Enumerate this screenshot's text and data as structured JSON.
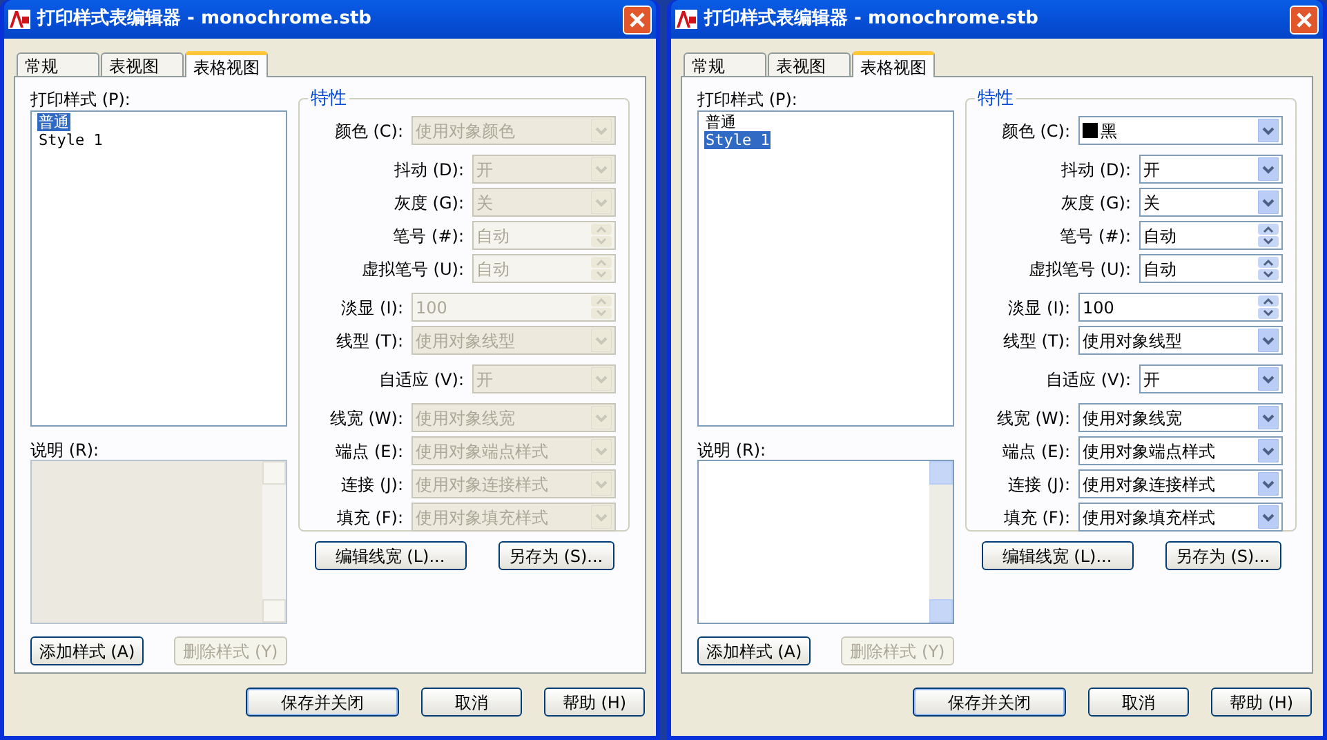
{
  "windows": [
    {
      "title": "打印样式表编辑器 - monochrome.stb",
      "tabs": [
        {
          "label": "常规",
          "selected": false
        },
        {
          "label": "表视图",
          "selected": false
        },
        {
          "label": "表格视图",
          "selected": true
        }
      ],
      "styles_label": "打印样式 (P):",
      "styles": [
        {
          "label": "普通",
          "selected": true
        },
        {
          "label": "Style 1",
          "selected": false
        }
      ],
      "description_label": "说明 (R):",
      "description": {
        "disabled": true
      },
      "list_buttons": [
        {
          "label": "添加样式 (A)",
          "disabled": false
        },
        {
          "label": "删除样式 (Y)",
          "disabled": true
        }
      ],
      "properties": {
        "title": "特性",
        "fields": [
          {
            "label": "颜色 (C):",
            "kind": "combo",
            "value": "使用对象颜色",
            "disabled": true
          },
          {
            "label": "抖动 (D):",
            "kind": "combo",
            "value": "开",
            "disabled": true
          },
          {
            "label": "灰度 (G):",
            "kind": "combo",
            "value": "关",
            "disabled": true
          },
          {
            "label": "笔号 (#):",
            "kind": "spin",
            "value": "自动",
            "disabled": true
          },
          {
            "label": "虚拟笔号 (U):",
            "kind": "spin",
            "value": "自动",
            "disabled": true
          },
          {
            "label": "淡显 (I):",
            "kind": "spin",
            "value": "100",
            "disabled": true
          },
          {
            "label": "线型 (T):",
            "kind": "combo",
            "value": "使用对象线型",
            "disabled": true
          },
          {
            "label": "自适应 (V):",
            "kind": "combo",
            "value": "开",
            "disabled": true
          },
          {
            "label": "线宽 (W):",
            "kind": "combo",
            "value": "使用对象线宽",
            "disabled": true
          },
          {
            "label": "端点 (E):",
            "kind": "combo",
            "value": "使用对象端点样式",
            "disabled": true
          },
          {
            "label": "连接 (J):",
            "kind": "combo",
            "value": "使用对象连接样式",
            "disabled": true
          },
          {
            "label": "填充 (F):",
            "kind": "combo",
            "value": "使用对象填充样式",
            "disabled": true
          }
        ]
      },
      "property_buttons": [
        "编辑线宽 (L)...",
        "另存为 (S)..."
      ],
      "footer_buttons": [
        "保存并关闭",
        "取消",
        "帮助 (H)"
      ]
    },
    {
      "title": "打印样式表编辑器 - monochrome.stb",
      "tabs": [
        {
          "label": "常规",
          "selected": false
        },
        {
          "label": "表视图",
          "selected": false
        },
        {
          "label": "表格视图",
          "selected": true
        }
      ],
      "styles_label": "打印样式 (P):",
      "styles": [
        {
          "label": "普通",
          "selected": false
        },
        {
          "label": "Style 1",
          "selected": true
        }
      ],
      "description_label": "说明 (R):",
      "description": {
        "disabled": false
      },
      "list_buttons": [
        {
          "label": "添加样式 (A)",
          "disabled": false
        },
        {
          "label": "删除样式 (Y)",
          "disabled": true
        }
      ],
      "properties": {
        "title": "特性",
        "fields": [
          {
            "label": "颜色 (C):",
            "kind": "combo",
            "value": "黑",
            "color": "#000000",
            "disabled": false
          },
          {
            "label": "抖动 (D):",
            "kind": "combo",
            "value": "开",
            "disabled": false
          },
          {
            "label": "灰度 (G):",
            "kind": "combo",
            "value": "关",
            "disabled": false
          },
          {
            "label": "笔号 (#):",
            "kind": "spin",
            "value": "自动",
            "disabled": false
          },
          {
            "label": "虚拟笔号 (U):",
            "kind": "spin",
            "value": "自动",
            "disabled": false
          },
          {
            "label": "淡显 (I):",
            "kind": "spin",
            "value": "100",
            "disabled": false
          },
          {
            "label": "线型 (T):",
            "kind": "combo",
            "value": "使用对象线型",
            "disabled": false
          },
          {
            "label": "自适应 (V):",
            "kind": "combo",
            "value": "开",
            "disabled": false
          },
          {
            "label": "线宽 (W):",
            "kind": "combo",
            "value": "使用对象线宽",
            "disabled": false
          },
          {
            "label": "端点 (E):",
            "kind": "combo",
            "value": "使用对象端点样式",
            "disabled": false
          },
          {
            "label": "连接 (J):",
            "kind": "combo",
            "value": "使用对象连接样式",
            "disabled": false
          },
          {
            "label": "填充 (F):",
            "kind": "combo",
            "value": "使用对象填充样式",
            "disabled": false
          }
        ]
      },
      "property_buttons": [
        "编辑线宽 (L)...",
        "另存为 (S)..."
      ],
      "footer_buttons": [
        "保存并关闭",
        "取消",
        "帮助 (H)"
      ]
    }
  ]
}
